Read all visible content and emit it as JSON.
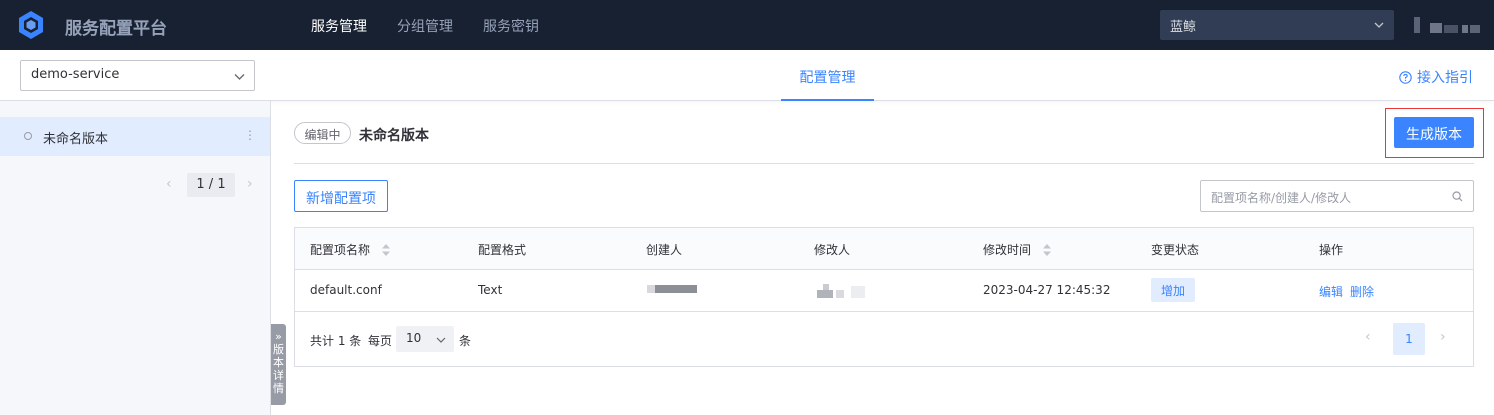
{
  "app": {
    "title": "服务配置平台",
    "logo_icon": "cube-logo-icon"
  },
  "nav": {
    "items": [
      {
        "label": "服务管理",
        "active": true
      },
      {
        "label": "分组管理",
        "active": false
      },
      {
        "label": "服务密钥",
        "active": false
      }
    ]
  },
  "biz": {
    "selected": "蓝鲸"
  },
  "service": {
    "selected": "demo-service"
  },
  "subnav": {
    "tab": "配置管理",
    "guide": "接入指引"
  },
  "sidebar": {
    "versions": [
      {
        "label": "未命名版本",
        "selected": true
      }
    ],
    "pager": "1 / 1"
  },
  "detail_toggle": {
    "label": "版本详情"
  },
  "main": {
    "status_tag": "编辑中",
    "version_name": "未命名版本",
    "generate_button": "生成版本",
    "add_button": "新增配置项",
    "search_placeholder": "配置项名称/创建人/修改人"
  },
  "table": {
    "columns": [
      "配置项名称",
      "配置格式",
      "创建人",
      "修改人",
      "修改时间",
      "变更状态",
      "操作"
    ],
    "rows": [
      {
        "name": "default.conf",
        "format": "Text",
        "created_at": "2023-04-27 12:45:32",
        "status": "增加",
        "actions": [
          "编辑",
          "删除"
        ]
      }
    ],
    "footer": {
      "total": "共计 1 条",
      "per_page_label": "每页",
      "page_size": "10",
      "per_page_unit": "条",
      "current_page": "1"
    }
  },
  "colors": {
    "primary": "#3a84ff",
    "topbar": "#182132",
    "highlight_border": "#ea3636"
  }
}
